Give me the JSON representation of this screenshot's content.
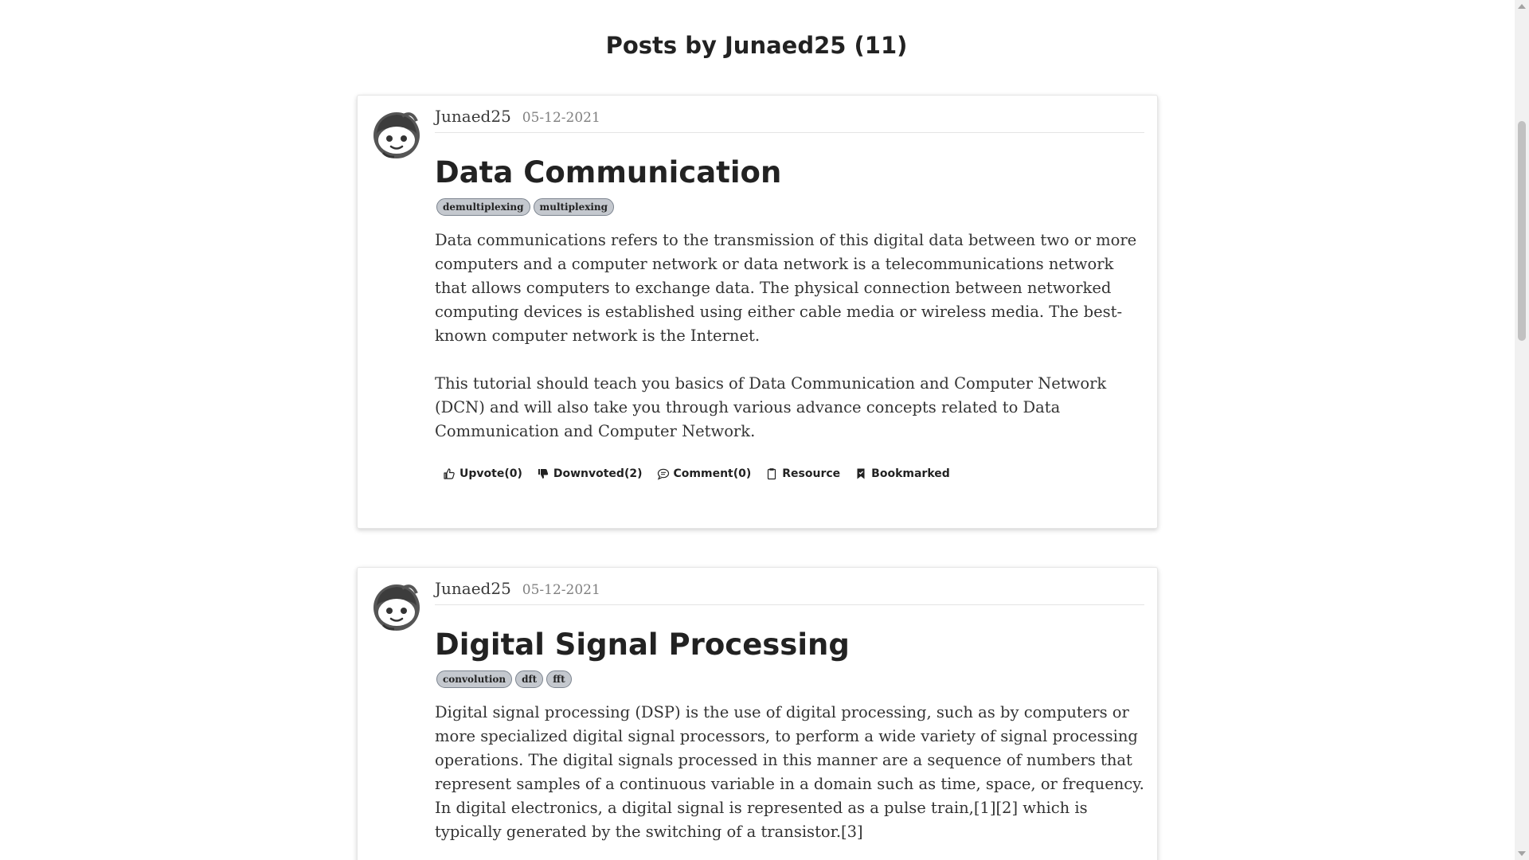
{
  "page": {
    "heading": "Posts by Junaed25 (11)"
  },
  "posts": [
    {
      "author": "Junaed25",
      "date": "05-12-2021",
      "title": "Data Communication",
      "tags": [
        "demultiplexing",
        "multiplexing"
      ],
      "paragraphs": [
        "Data communications refers to the transmission of this digital data between two or more computers and a computer network or data network is a telecommunications network that allows computers to exchange data. The physical connection between networked computing devices is established using either cable media or wireless media. The best-known computer network is the Internet.",
        "This tutorial should teach you basics of Data Communication and Computer Network (DCN) and will also take you through various advance concepts related to Data Communication and Computer Network."
      ],
      "actions": {
        "upvote": "Upvote(0)",
        "downvote": "Downvoted(2)",
        "comment": "Comment(0)",
        "resource": "Resource",
        "bookmark": "Bookmarked"
      }
    },
    {
      "author": "Junaed25",
      "date": "05-12-2021",
      "title": "Digital Signal Processing",
      "tags": [
        "convolution",
        "dft",
        "fft"
      ],
      "paragraphs": [
        "Digital signal processing (DSP) is the use of digital processing, such as by computers or more specialized digital signal processors, to perform a wide variety of signal processing operations. The digital signals processed in this manner are a sequence of numbers that represent samples of a continuous variable in a domain such as time, space, or frequency. In digital electronics, a digital signal is represented as a pulse train,[1][2] which is typically generated by the switching of a transistor.[3]"
      ]
    }
  ],
  "icons": {
    "avatar": "reddit-robot-avatar-icon",
    "upvote": "thumbs-up-outline-icon",
    "downvote": "thumbs-down-filled-icon",
    "comment": "speech-bubble-icon",
    "resource": "clipboard-icon",
    "bookmark": "bookmark-filled-icon"
  },
  "colors": {
    "tag_bg": "#c4c8ce",
    "tag_border": "#7d8590",
    "text": "#333333",
    "heading": "#222222"
  }
}
